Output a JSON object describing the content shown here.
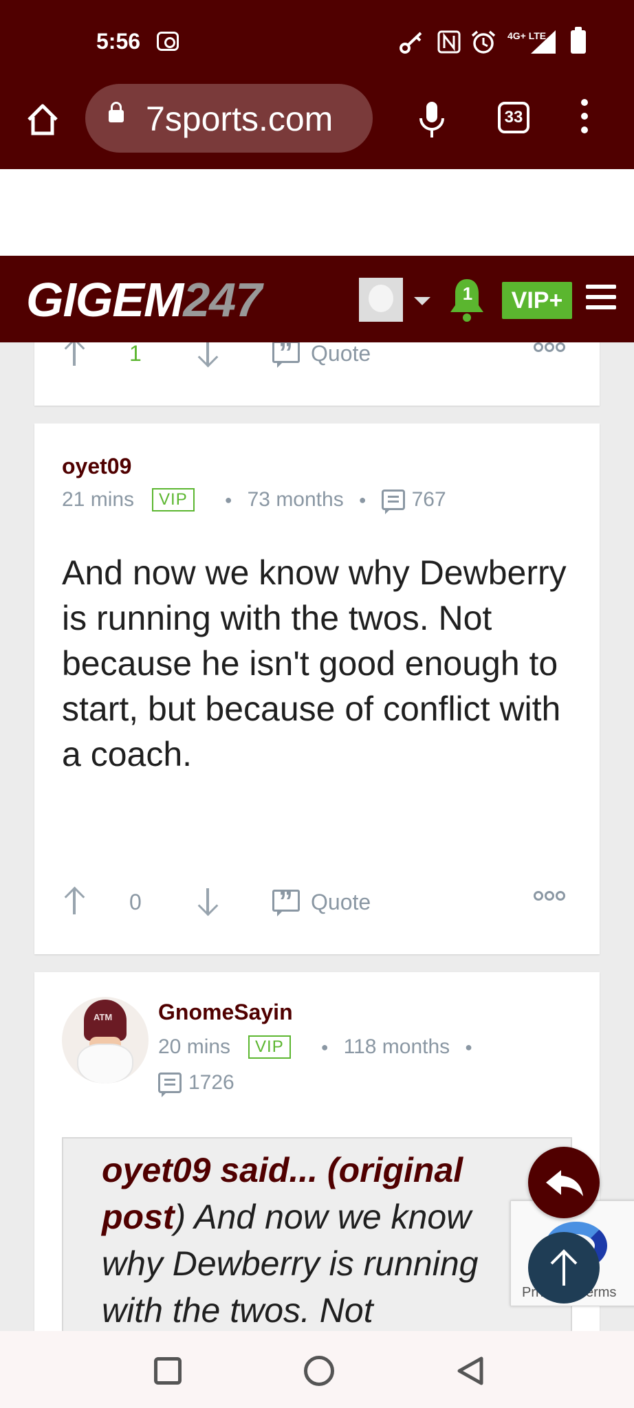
{
  "status_bar": {
    "time": "5:56",
    "network": "4G+ LTE"
  },
  "browser": {
    "url": "7sports.com",
    "tab_count": "33"
  },
  "site": {
    "logo_main": "GIGEM",
    "logo_num": "247",
    "notification_count": "1",
    "vip_button": "VIP+"
  },
  "posts": [
    {
      "upvotes": "1",
      "quote_label": "Quote"
    },
    {
      "username": "oyet09",
      "time": "21 mins",
      "badge": "VIP",
      "tenure": "73 months",
      "post_count": "767",
      "body": "And now we know why Dewberry is running with the twos. Not because he isn't good enough to start, but because of conflict with a coach.",
      "upvotes": "0",
      "quote_label": "Quote"
    },
    {
      "username": "GnomeSayin",
      "time": "20 mins",
      "badge": "VIP",
      "tenure": "118 months",
      "post_count": "1726",
      "quote_author": "oyet09 said... (original post",
      "quote_text": ") And now we know why Dewberry is running with the twos. Not"
    }
  ],
  "recaptcha": {
    "text": "Privacy - Terms"
  },
  "colors": {
    "brand_maroon": "#500000",
    "vip_green": "#5bb62f",
    "meta_gray": "#8a97a3"
  }
}
